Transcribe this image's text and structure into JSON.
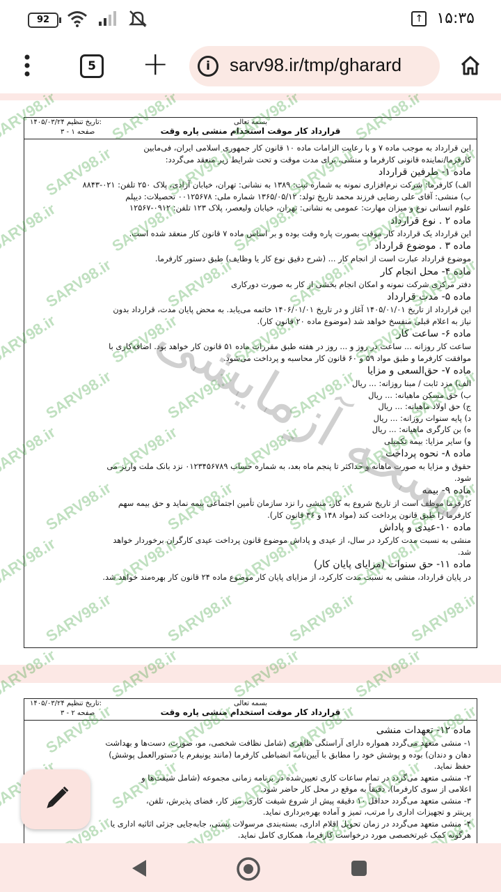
{
  "status_bar": {
    "battery": "92",
    "time": "۱۵:۳۵"
  },
  "browser": {
    "tab_count": "5",
    "url": "sarv98.ir/tmp/gharard"
  },
  "watermark_text": "SARV98.ir",
  "stamp_text": "نسخه آزمایشی",
  "page1": {
    "date_label": "تاریخ تنظیم:",
    "date": "۱۴۰۵/۰۳/۲۴",
    "page_label": "صفحه ۱ - ۳",
    "besmellah": "بسمه تعالی",
    "title": "قرارداد کار موقت استخدام منشی پاره وقت",
    "lines": [
      "این قرارداد به موجب ماده ۷ و با رعایت الزامات ماده ۱۰ قانون کار جمهوری اسلامی ایران، فی‌مابین",
      "کارفرما/نماینده قانونی کارفرما و منشی، برای مدت موقت و تحت شرایط زیر منعقد می‌گردد:",
      "ماده ۱- طرفین قرارداد",
      "الف) کارفرما: شرکت نرم‌افزاری نمونه به شماره ثبت: ۱۳۸۹ به نشانی: تهران، خیابان آزادی، پلاک ۲۵۰ تلفن: ۰۲۱-۸۸۴۳",
      "ب) منشی: آقای علی رضایی فرزند محمد تاریخ تولد: ۱۳۶۵/۰۵/۱۲ شماره ملی: ۰۰۱۲۵۶۷۸ تحصیلات: دیپلم",
      "علوم انسانی نوع و میزان مهارت: عمومی به نشانی: تهران، خیابان ولیعصر، پلاک ۱۲۳ تلفن: ۰۹۱۲-۱۲۵۶۷",
      "ماده ۲ . نوع قرارداد",
      "این قرارداد یک قرارداد کار موقت بصورت پاره وقت بوده و بر اساس ماده ۷ قانون کار منعقد شده است.",
      "ماده ۳ . موضوع قرارداد",
      "موضوع قرارداد عبارت است از انجام کار ... (شرح دقیق نوع کار یا وظایف) طبق دستور کارفرما.",
      "ماده ۴- محل انجام کار",
      "دفتر مرکزی شرکت نمونه و امکان انجام بخشی از کار به صورت دورکاری",
      "ماده ۵- مدت قرارداد",
      "این قرارداد از تاریخ ۱۴۰۵/۰۱/۰۱ آغاز و در تاریخ ۱۴۰۶/۰۱/۰۱ خاتمه می‌یابد. به محض پایان مدت، قرارداد بدون",
      "نیاز به اعلام قبلی منفسخ خواهد شد (موضوع ماده ۲۰ قانون کار).",
      "ماده ۶- ساعت کار",
      "ساعت کار روزانه ... ساعت در روز و ... روز در هفته طبق مقررات ماده ۵۱ قانون کار خواهد بود. اضافه‌کاری با",
      "موافقت کارفرما و طبق مواد ۵۹ و ۶۰ قانون کار محاسبه و پرداخت می‌شود.",
      "ماده ۷- حق‌السعی و مزایا",
      "الف) مزد ثابت / مبنا روزانه: ... ریال",
      "ب) حق مسکن ماهیانه: ... ریال",
      "ج) حق اولاد ماهیانه: ... ریال",
      "د) پایه سنوات روزانه: ... ریال",
      "ه) بن کارگری ماهیانه: ... ریال",
      "و) سایر مزایا: بیمه تکمیلی",
      "ماده ۸- نحوه پرداخت",
      "حقوق و مزایا به صورت ماهانه و حداکثر تا پنجم ماه بعد، به شماره حساب ۰۱۲۳۴۵۶۷۸۹ نزد بانک ملت واریز می",
      "شود.",
      "ماده ۹- بیمه",
      "کارفرما موظف است از تاریخ شروع به کار، منشی را نزد سازمان تأمین اجتماعی بیمه نماید و حق بیمه سهم",
      "کارفرما را طبق قانون پرداخت کند (مواد ۱۴۸ و ۳۶ قانون کار).",
      "ماده ۱۰-عیدی و پاداش",
      "منشی به نسبت مدت کارکرد در سال، از عیدی و پاداش موضوع قانون پرداخت عیدی کارگران برخوردار خواهد",
      "شد.",
      "ماده ۱۱- حق سنوات (مزایای پایان کار)",
      "در پایان قرارداد، منشی به نسبت مدت کارکرد، از مزایای پایان کار موضوع ماده ۲۴ قانون کار بهره‌مند خواهد شد."
    ],
    "headings": [
      2,
      6,
      8,
      10,
      12,
      15,
      18,
      25,
      28,
      31,
      34
    ]
  },
  "page2": {
    "date_label": "تاریخ تنظیم:",
    "date": "۱۴۰۵/۰۳/۲۴",
    "page_label": "صفحه ۲ - ۳",
    "besmellah": "بسمه تعالی",
    "title": "قرارداد کار موقت استخدام منشی پاره وقت",
    "lines": [
      "ماده ۱۲- تعهدات منشی",
      "۱- منشی متعهد می‌گردد همواره دارای آراستگی ظاهری (شامل نظافت شخصی، مو، صورت، دست‌ها و بهداشت",
      "دهان و دندان) بوده و پوشش خود را مطابق با آیین‌نامه انضباطی کارفرما (مانند یونیفرم یا دستورالعمل پوشش)",
      "حفظ نماید.",
      "۲- منشی متعهد می‌گردد در تمام ساعات کاری تعیین‌شده در برنامه زمانی مجموعه (شامل شیفت‌ها و",
      "اعلامی از سوی کارفرما)، دقیقاً به موقع در محل کار حاضر شود.",
      "۳- منشی متعهد می‌گردد حداقل ۱۰ دقیقه پیش از شروع شیفت کاری، میز کار، فضای پذیرش، تلفن،",
      "پرینتر و تجهیزات اداری را مرتب، تمیز و آماده بهره‌برداری نماید.",
      "۴- منشی متعهد می‌گردد در زمان تحویل اقلام اداری، بسته‌بندی مرسولات پستی، جابه‌جایی جزئی اثاثیه اداری یا",
      "هرگونه کمک غیرتخصصی مورد درخواست کارفرما، همکاری کامل نماید."
    ],
    "headings": [
      0
    ]
  }
}
